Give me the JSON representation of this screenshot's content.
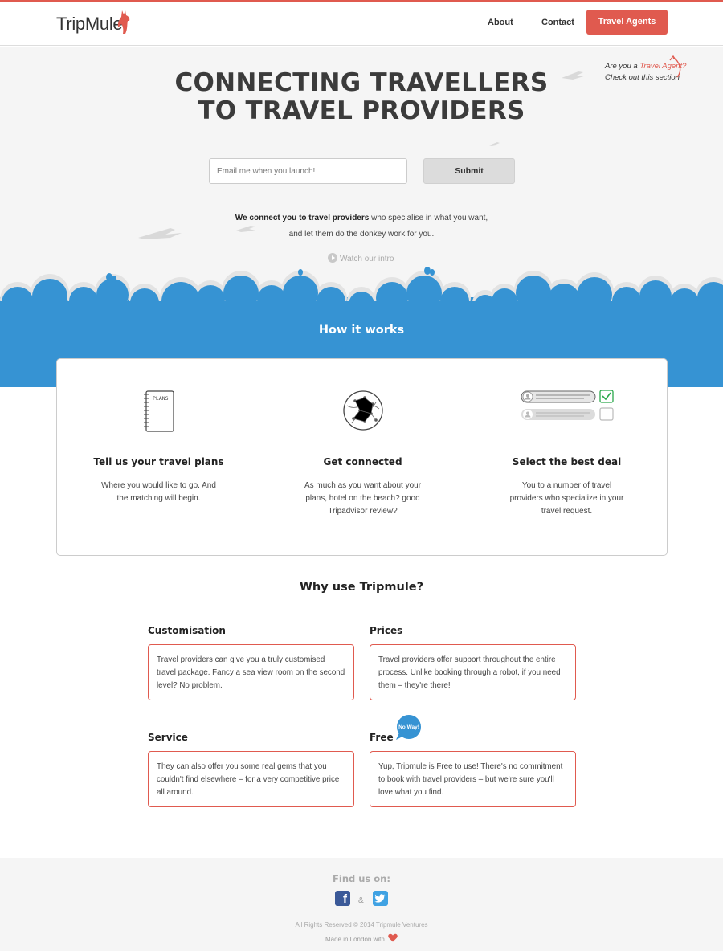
{
  "header": {
    "logo_text": "TripMule",
    "nav": [
      {
        "label": "About"
      },
      {
        "label": "Contact"
      }
    ],
    "agents_button": "Travel Agents"
  },
  "hero": {
    "title_line1": "CONNECTING TRAVELLERS",
    "title_line2": "TO TRAVEL PROVIDERS",
    "agent_note_prefix": "Are you a ",
    "agent_note_link": "Travel Agent?",
    "agent_note_line2": "Check out this section",
    "email_placeholder": "Email me when you launch!",
    "submit_label": "Submit",
    "intro_bold": "We connect you to travel providers",
    "intro_rest": " who specialise in what you want,",
    "intro_line2": "and let them do the donkey work for you.",
    "watch_label": "Watch our intro"
  },
  "how": {
    "title": "How it works",
    "steps": [
      {
        "icon": "notebook-icon",
        "icon_text": "PLANS",
        "title": "Tell us your travel plans",
        "desc": "Where you would like to go. And the matching will begin."
      },
      {
        "icon": "globe-network-icon",
        "title": "Get connected",
        "desc": "As much as you want about your plans, hotel on the beach? good Tripadvisor review?"
      },
      {
        "icon": "select-deal-icon",
        "title": "Select the best deal",
        "desc": "You to a number of travel providers who specialize in your travel request."
      }
    ]
  },
  "why": {
    "title": "Why use Tripmule?",
    "features": [
      {
        "title": "Customisation",
        "text": "Travel providers can give you a truly customised travel package. Fancy a sea view room on the second level? No problem."
      },
      {
        "title": "Prices",
        "text": "Travel providers offer support throughout the entire process. Unlike booking through a robot, if you need them – they're there!"
      },
      {
        "title": "Service",
        "text": "They can also offer you some real gems that you couldn't find elsewhere – for a very competitive price all around."
      },
      {
        "title": "Free",
        "text": "Yup, Tripmule is Free to use! There's no commitment to book with travel providers – but we're sure you'll love what you find."
      }
    ],
    "badge": "No Way!"
  },
  "footer": {
    "find_us": "Find us on:",
    "amp": "&",
    "copyright": "All Rights Reserved © 2014 Tripmule Ventures",
    "made_in": "Made in London with"
  },
  "colors": {
    "accent_red": "#e05a4f",
    "brand_blue": "#3693d3",
    "facebook": "#3b5998",
    "twitter": "#40a2e3"
  }
}
